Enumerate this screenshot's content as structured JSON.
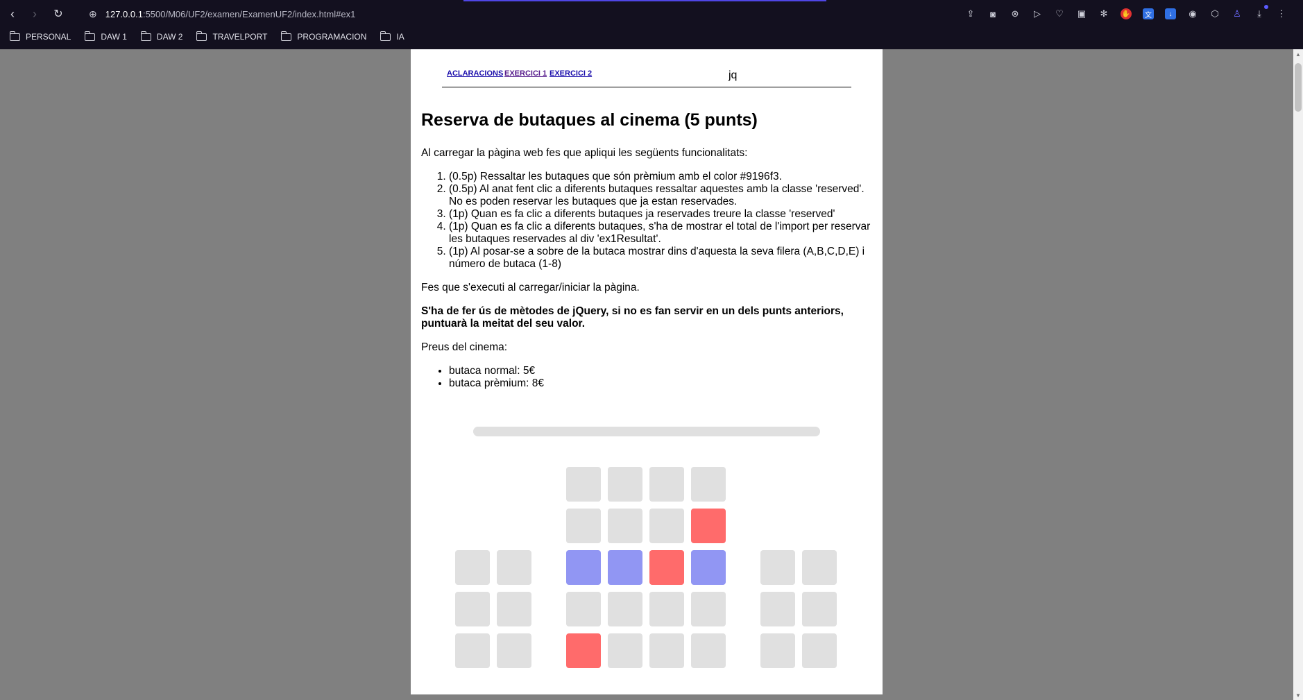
{
  "browser": {
    "url_host": "127.0.0.1",
    "url_path": ":5500/M06/UF2/examen/ExamenUF2/index.html#ex1",
    "bookmarks": [
      "PERSONAL",
      "DAW 1",
      "DAW 2",
      "TRAVELPORT",
      "PROGRAMACION",
      "IA"
    ]
  },
  "nav": {
    "links": [
      "ACLARACIONS",
      "EXERCICI 1",
      "EXERCICI 2"
    ],
    "label": "jq"
  },
  "content": {
    "title": "Reserva de butaques al cinema (5 punts)",
    "intro": "Al carregar la pàgina web fes que apliqui les següents funcionalitats:",
    "tasks": [
      "(0.5p) Ressaltar les butaques que són prèmium amb el color #9196f3.",
      "(0.5p) Al anat fent clic a diferents butaques ressaltar aquestes amb la classe 'reserved'. No es poden reservar les butaques que ja estan reservades.",
      "(1p) Quan es fa clic a diferents butaques ja reservades treure la classe 'reserved'",
      "(1p) Quan es fa clic a diferents butaques, s'ha de mostrar el total de l'import per reservar les butaques reservades al div 'ex1Resultat'.",
      "(1p) Al posar-se a sobre de la butaca mostrar dins d'aquesta la seva filera (A,B,C,D,E) i número de butaca (1-8)"
    ],
    "execute_note": "Fes que s'executi al carregar/iniciar la pàgina.",
    "jquery_note": "S'ha de fer ús de mètodes de jQuery, si no es fan servir en un dels punts anteriors, puntuarà la meitat del seu valor.",
    "prices_title": "Preus del cinema:",
    "prices": [
      "butaca normal: 5€",
      "butaca prèmium: 8€"
    ]
  },
  "seating": {
    "colors": {
      "normal": "#e0e0e0",
      "premium": "#9196f3",
      "reserved": "#ff6b6b"
    },
    "rows": [
      [
        "empty",
        "empty",
        "normal",
        "normal",
        "normal",
        "normal",
        "empty",
        "empty"
      ],
      [
        "empty",
        "empty",
        "normal",
        "normal",
        "normal",
        "reserved",
        "empty",
        "empty"
      ],
      [
        "normal",
        "normal",
        "premium",
        "premium",
        "reserved",
        "premium",
        "normal",
        "normal"
      ],
      [
        "normal",
        "normal",
        "normal",
        "normal",
        "normal",
        "normal",
        "normal",
        "normal"
      ],
      [
        "normal",
        "normal",
        "reserved",
        "normal",
        "normal",
        "normal",
        "normal",
        "normal"
      ]
    ]
  }
}
